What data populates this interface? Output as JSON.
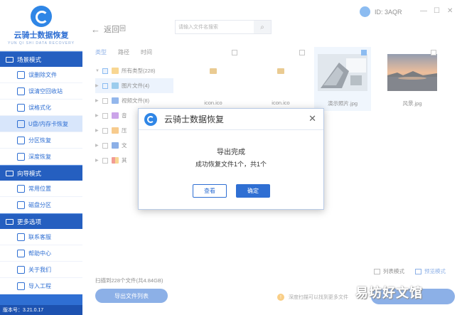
{
  "app": {
    "title": "云骑士数据恢复",
    "subtitle": "YUN QI SHI DATA RECOVERY",
    "id_text": "ID: 3AQR",
    "version": "版本号：3.21.0.17"
  },
  "sidebar": {
    "sections": [
      {
        "label": "场景模式",
        "items": [
          "误删除文件",
          "误清空回收站",
          "误格式化",
          "U盘/内存卡恢复",
          "分区恢复",
          "深度恢复"
        ]
      },
      {
        "label": "向导模式",
        "items": [
          "常用位置",
          "磁盘分区"
        ]
      },
      {
        "label": "更多选项",
        "items": [
          "联系客服",
          "帮助中心",
          "关于我们",
          "导入工程"
        ]
      }
    ]
  },
  "toolbar": {
    "back_label": "返回",
    "home_label": "回",
    "search_placeholder": "请输入文件名搜索"
  },
  "tabs": [
    "类型",
    "路径",
    "时间"
  ],
  "tree": [
    {
      "label": "所有类型(228)"
    },
    {
      "label": "图片文件(4)"
    },
    {
      "label": "视频文件(8)"
    },
    {
      "label": "音"
    },
    {
      "label": "压"
    },
    {
      "label": "文"
    },
    {
      "label": "其"
    }
  ],
  "files": [
    {
      "name": "icon.ico",
      "checked": false
    },
    {
      "name": "icon.ico",
      "checked": false
    },
    {
      "name": "演示照片.jpg",
      "checked": true
    },
    {
      "name": "风景.jpg",
      "checked": false
    }
  ],
  "status": {
    "scan_text": "扫描到228个文件(共4.84GB)",
    "export_list": "导出文件列表",
    "list_mode": "列表模式",
    "thumb_mode": "预览模式",
    "tip": "深度扫描可以找到更多文件"
  },
  "watermark": "易坊好文馆",
  "dialog": {
    "title": "云骑士数据恢复",
    "line1": "导出完成",
    "line2": "成功恢复文件1个，共1个",
    "view_btn": "查看",
    "ok_btn": "确定"
  }
}
